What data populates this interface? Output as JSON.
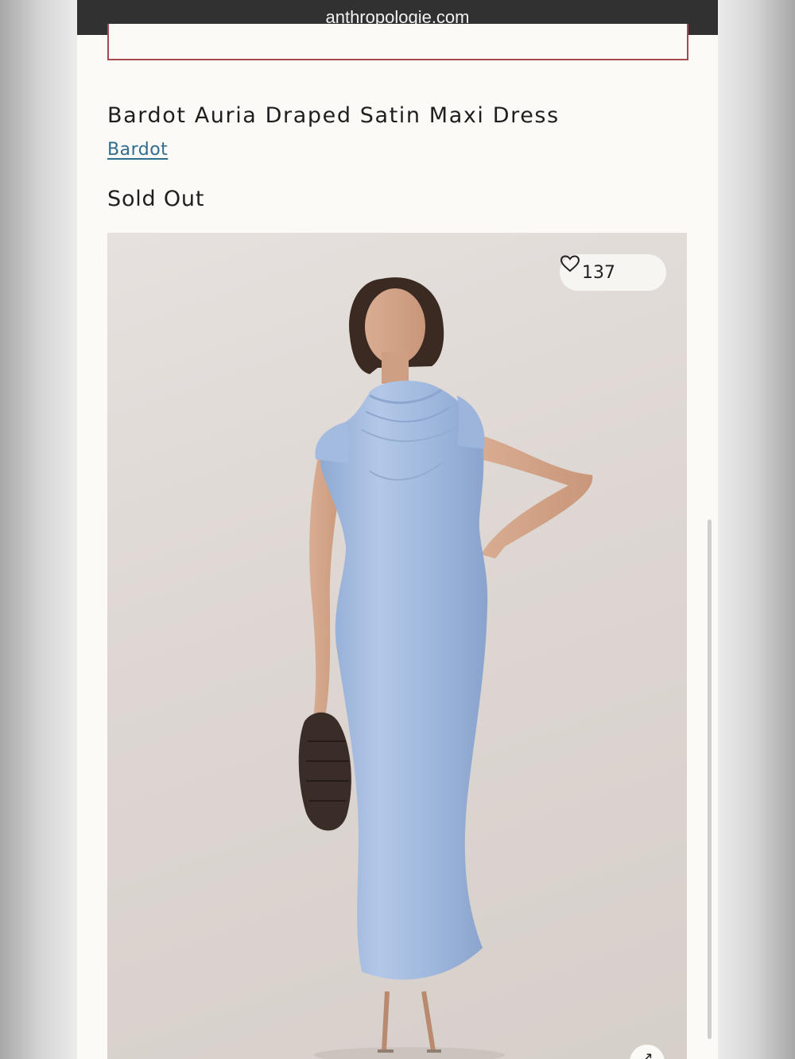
{
  "browser": {
    "url": "anthropologie.com"
  },
  "product": {
    "title": "Bardot Auria Draped Satin Maxi Dress",
    "brand": "Bardot",
    "status": "Sold Out",
    "favorite_count": "137",
    "favorite_icon": "heart-icon",
    "expand_icon": "arrow-expand-icon"
  },
  "colors": {
    "url_bar_bg": "#313131",
    "brand_link": "#2f6c8e",
    "box_border": "#a44a4f",
    "dress": "#a9c1e4"
  }
}
